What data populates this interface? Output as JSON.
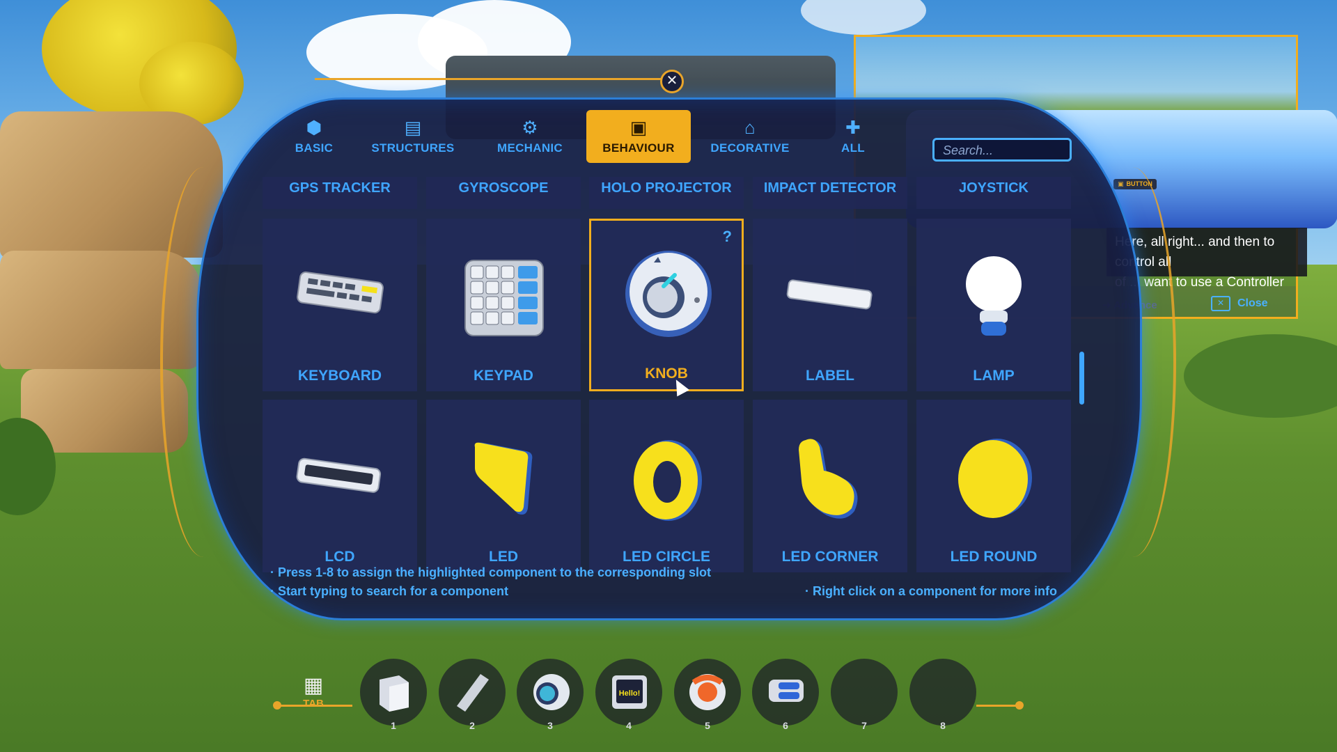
{
  "tabs": [
    {
      "label": "BASIC",
      "icon": "cube-icon",
      "active": false
    },
    {
      "label": "STRUCTURES",
      "icon": "structure-icon",
      "active": false
    },
    {
      "label": "MECHANIC",
      "icon": "mechanic-icon",
      "active": false
    },
    {
      "label": "BEHAVIOUR",
      "icon": "chip-icon",
      "active": true
    },
    {
      "label": "DECORATIVE",
      "icon": "decorative-icon",
      "active": false
    },
    {
      "label": "ALL",
      "icon": "all-icon",
      "active": false
    }
  ],
  "search": {
    "placeholder": "Search..."
  },
  "top_row": [
    "GPS TRACKER",
    "GYROSCOPE",
    "HOLO PROJECTOR",
    "IMPACT DETECTOR",
    "JOYSTICK"
  ],
  "components_row1": [
    {
      "label": "KEYBOARD",
      "icon": "keyboard-icon"
    },
    {
      "label": "KEYPAD",
      "icon": "keypad-icon"
    },
    {
      "label": "KNOB",
      "icon": "knob-icon",
      "selected": true,
      "help": "?"
    },
    {
      "label": "LABEL",
      "icon": "label-icon"
    },
    {
      "label": "LAMP",
      "icon": "lamp-icon"
    }
  ],
  "components_row2": [
    {
      "label": "LCD",
      "icon": "lcd-icon"
    },
    {
      "label": "LED",
      "icon": "led-icon"
    },
    {
      "label": "LED CIRCLE",
      "icon": "led-circle-icon"
    },
    {
      "label": "LED CORNER",
      "icon": "led-corner-icon"
    },
    {
      "label": "LED ROUND",
      "icon": "led-round-icon"
    }
  ],
  "hints": {
    "assign": "· Press 1-8 to assign the highlighted component to the corresponding slot",
    "search": "· Start typing to search for a component",
    "info": "· Right click on a component for more info"
  },
  "tutorial": {
    "badge": "BUTTON",
    "caption_line1": "Here, all right... and then to control all",
    "caption_line2": "of ... want to use a Controller",
    "advance": "Advance",
    "close": "Close"
  },
  "hotbar": {
    "tab_label": "TAB",
    "slots": [
      {
        "num": "1",
        "item": "cube-block-icon"
      },
      {
        "num": "2",
        "item": "cylinder-icon"
      },
      {
        "num": "3",
        "item": "sensor-icon"
      },
      {
        "num": "4",
        "item": "screen-hello-icon",
        "text": "Hello!"
      },
      {
        "num": "5",
        "item": "motor-icon"
      },
      {
        "num": "6",
        "item": "magnet-icon"
      },
      {
        "num": "7",
        "item": "empty"
      },
      {
        "num": "8",
        "item": "empty"
      }
    ]
  },
  "colors": {
    "accent": "#f2ae1e",
    "primary": "#3fa6ff",
    "panel": "#181e42"
  }
}
